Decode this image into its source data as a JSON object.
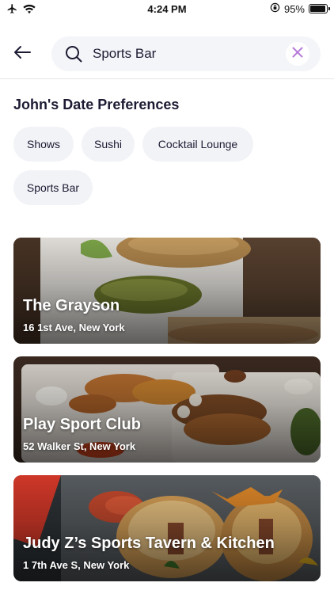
{
  "status_bar": {
    "time": "4:24 PM",
    "battery_text": "95%",
    "battery_level": 0.95,
    "icons": [
      "airplane-icon",
      "wifi-icon",
      "orientation-lock-icon",
      "battery-icon"
    ]
  },
  "search": {
    "value": "Sports Bar",
    "placeholder": "Search",
    "icons": [
      "back-arrow-icon",
      "search-icon",
      "clear-x-icon"
    ]
  },
  "preferences": {
    "title": "John's Date Preferences",
    "chips": [
      "Shows",
      "Sushi",
      "Cocktail Lounge",
      "Sports Bar"
    ]
  },
  "venues": [
    {
      "name": "The Grayson",
      "address": "16 1st Ave, New York"
    },
    {
      "name": "Play Sport Club",
      "address": "52 Walker St, New York"
    },
    {
      "name": "Judy Z’s Sports Tavern & Kitchen",
      "address": "1 7th Ave S, New York"
    }
  ],
  "colors": {
    "accent": "#b57ad9",
    "text": "#1c1b33",
    "chip_bg": "#f2f3f7",
    "search_bg": "#f4f5f9"
  }
}
